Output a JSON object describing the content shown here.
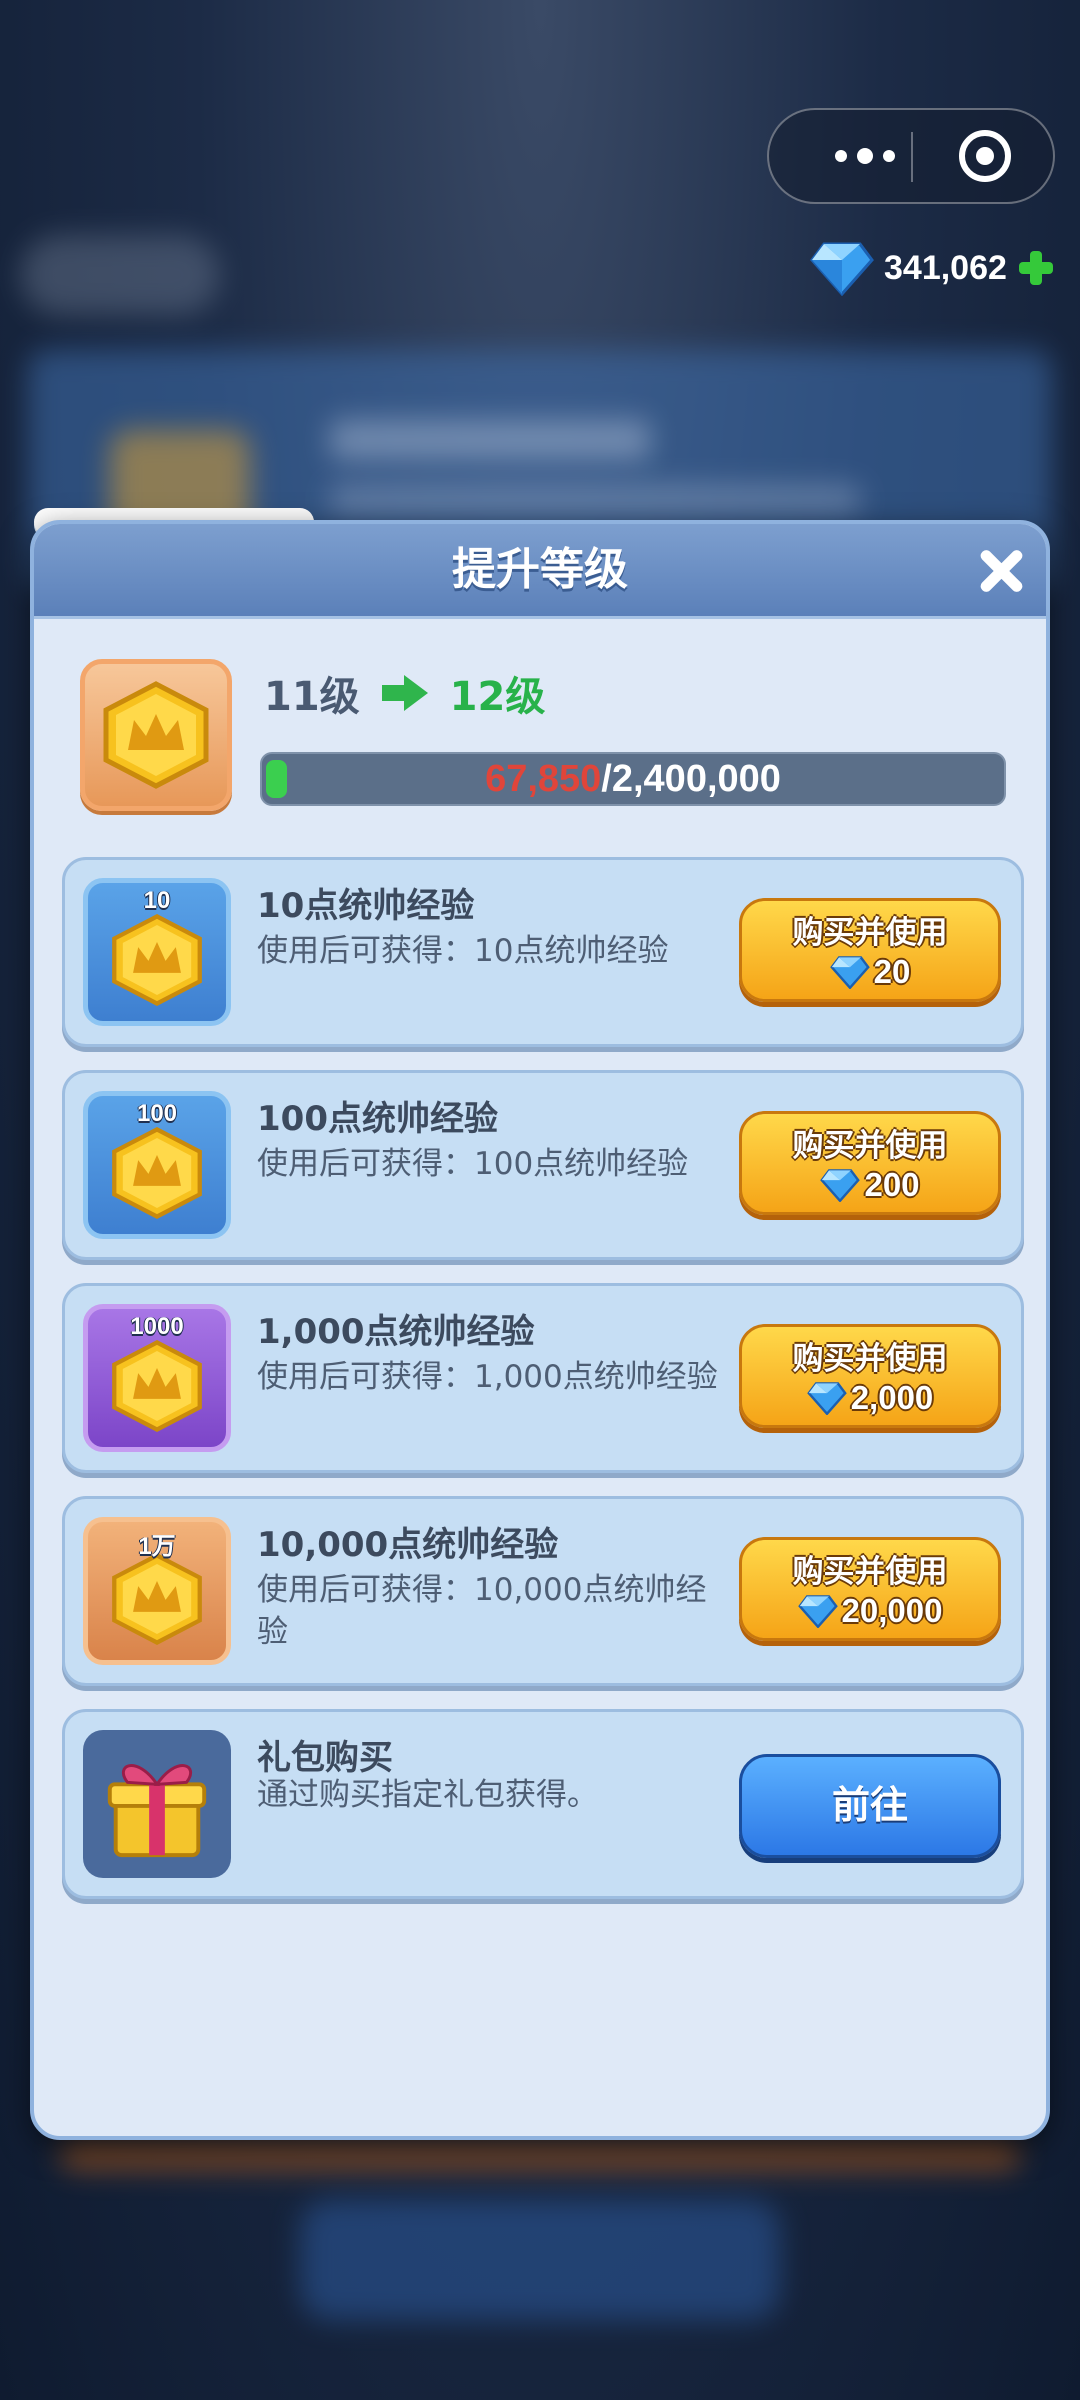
{
  "currency": {
    "amount": "341,062",
    "icon": "diamond-icon",
    "add_icon": "plus-icon"
  },
  "dialog": {
    "title": "提升等级",
    "close_icon": "close-icon",
    "level": {
      "from": "11级",
      "to": "12级",
      "current": "67,850",
      "separator": "/",
      "total": "2,400,000",
      "progress_fraction": 0.028
    },
    "items": [
      {
        "tag": "10",
        "name": "10点统帅经验",
        "desc": "使用后可获得：10点统帅经验",
        "button": "购买并使用",
        "price": "20",
        "icon_color": "blue"
      },
      {
        "tag": "100",
        "name": "100点统帅经验",
        "desc": "使用后可获得：100点统帅经验",
        "button": "购买并使用",
        "price": "200",
        "icon_color": "blue"
      },
      {
        "tag": "1000",
        "name": "1,000点统帅经验",
        "desc": "使用后可获得：1,000点统帅经验",
        "button": "购买并使用",
        "price": "2,000",
        "icon_color": "purple"
      },
      {
        "tag": "1万",
        "name": "10,000点统帅经验",
        "desc": "使用后可获得：10,000点统帅经验",
        "button": "购买并使用",
        "price": "20,000",
        "icon_color": "orange"
      }
    ],
    "gift": {
      "name": "礼包购买",
      "desc": "通过购买指定礼包获得。",
      "button": "前往",
      "icon": "gift-box-icon"
    }
  },
  "colors": {
    "accent_green": "#28b24a",
    "progress_red": "#e0453a",
    "buy_button": "#f5a417",
    "go_button": "#2c78e6"
  }
}
